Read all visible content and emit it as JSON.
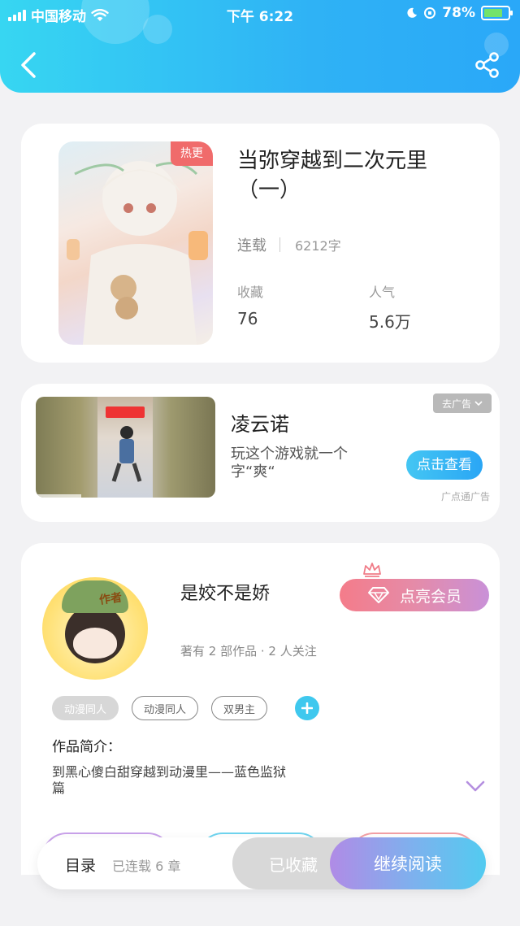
{
  "status_bar": {
    "carrier": "中国移动",
    "time": "下午 6:22",
    "battery": "78%",
    "battery_level": 0.78
  },
  "header": {
    "back_icon": "chevron-left-icon",
    "share_icon": "share-icon"
  },
  "book": {
    "badge": "热更",
    "title": "当弥穿越到二次元里（一）",
    "status": "连载",
    "word_count": "6212字",
    "favorites_label": "收藏",
    "favorites_value": "76",
    "popularity_label": "人气",
    "popularity_value": "5.6万"
  },
  "ad": {
    "title": "凌云诺",
    "description": "玩这个游戏就一个字“爽“",
    "remove_label": "去广告",
    "cta_label": "点击查看",
    "source": "广点通广告"
  },
  "author": {
    "avatar_tag": "作者",
    "name": "是姣不是娇",
    "info": "著有 2 部作品 · 2 人关注",
    "vip_button": "点亮会员",
    "tags": [
      "动漫同人",
      "动漫同人",
      "双男主"
    ],
    "intro_label": "作品简介：",
    "intro_text": "到黑心傻白甜穿越到动漫里——蓝色监狱篇"
  },
  "bottom_bar": {
    "toc_label": "目录",
    "chapters": "已连载 6 章",
    "favorited_label": "已收藏",
    "continue_label": "继续阅读"
  },
  "colors": {
    "header_gradient_start": "#37d6f2",
    "header_gradient_end": "#2aa8f8",
    "hot_badge": "#f06b6b",
    "vip_gradient_start": "#f47c8a",
    "vip_gradient_end": "#c991d8",
    "read_gradient_start": "#b08be6",
    "read_gradient_end": "#52cbf0"
  }
}
